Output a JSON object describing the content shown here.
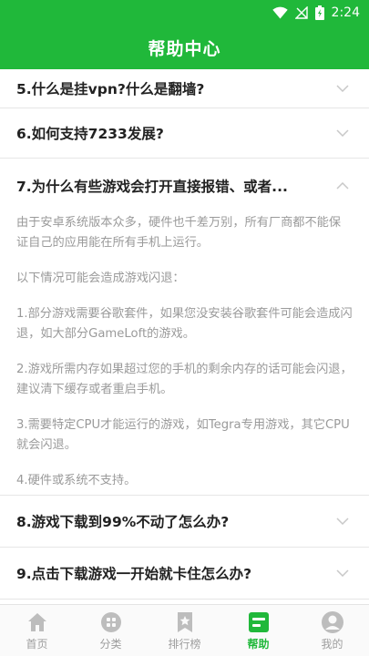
{
  "status_bar": {
    "time": "2:24"
  },
  "header": {
    "title": "帮助中心"
  },
  "faq": [
    {
      "question": "5.什么是挂vpn?什么是翻墙?",
      "expanded": false
    },
    {
      "question": "6.如何支持7233发展?",
      "expanded": false
    },
    {
      "question": "7.为什么有些游戏会打开直接报错、或者...",
      "expanded": true,
      "answer": [
        "由于安卓系统版本众多，硬件也千差万别，所有厂商都不能保证自己的应用能在所有手机上运行。",
        "以下情况可能会造成游戏闪退：",
        "1.部分游戏需要谷歌套件，如果您没安装谷歌套件可能会造成闪退，如大部分GameLoft的游戏。",
        "2.游戏所需内存如果超过您的手机的剩余内存的话可能会闪退，建议清下缓存或者重启手机。",
        "3.需要特定CPU才能运行的游戏，如Tegra专用游戏，其它CPU 就会闪退。",
        "4.硬件或系统不支持。"
      ]
    },
    {
      "question": "8.游戏下载到99%不动了怎么办?",
      "expanded": false
    },
    {
      "question": "9.点击下载游戏一开始就卡住怎么办?",
      "expanded": false
    }
  ],
  "tabs": [
    {
      "label": "首页",
      "icon": "home-icon",
      "active": false
    },
    {
      "label": "分类",
      "icon": "category-icon",
      "active": false
    },
    {
      "label": "排行榜",
      "icon": "ranking-icon",
      "active": false
    },
    {
      "label": "帮助",
      "icon": "help-icon",
      "active": true
    },
    {
      "label": "我的",
      "icon": "profile-icon",
      "active": false
    }
  ],
  "colors": {
    "brand_green": "#20b83a",
    "muted_text": "#9a9a9a",
    "tab_inactive": "#9d9d9d"
  }
}
